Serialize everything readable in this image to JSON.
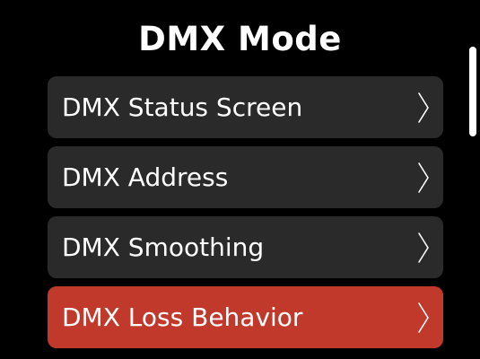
{
  "screen": {
    "title": "DMX Mode"
  },
  "menu": {
    "items": [
      {
        "label": "DMX Status Screen",
        "icon": "chevron-right-icon",
        "selected": false
      },
      {
        "label": "DMX Address",
        "icon": "chevron-right-icon",
        "selected": false
      },
      {
        "label": "DMX Smoothing",
        "icon": "chevron-right-icon",
        "selected": false
      },
      {
        "label": "DMX Loss Behavior",
        "icon": "chevron-right-icon",
        "selected": true
      }
    ]
  },
  "colors": {
    "background": "#000000",
    "item_background": "#2a2a2a",
    "selected_background": "#c0392b",
    "text": "#ffffff"
  }
}
